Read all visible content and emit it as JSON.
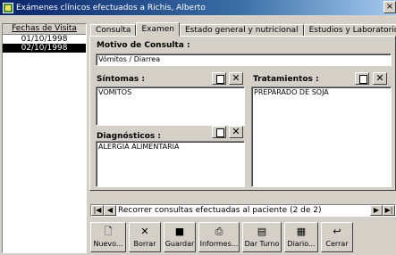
{
  "window": {
    "title": "Exámenes clínicos efectuados a Richis, Alberto",
    "close_glyph": "×"
  },
  "visits": {
    "header": "Fechas de Visita",
    "dates": [
      "01/10/1998",
      "02/10/1998"
    ]
  },
  "tabs": [
    "Consulta",
    "Examen",
    "Estado general y nutricional",
    "Estudios y Laboratorio"
  ],
  "consulta": {
    "motivo_label": "Motivo de Consulta :",
    "motivo_value": "Vómitos / Diarrea",
    "sintomas_label": "Síntomas :",
    "sintomas_value": "VOMITOS",
    "tratamientos_label": "Tratamientos :",
    "tratamientos_value": "PREPARADO DE SOJA",
    "diagnosticos_label": "Diagnósticos :",
    "diagnosticos_value": "ALERGIA ALIMENTARIA"
  },
  "navigator": {
    "text": "Recorrer consultas efectuadas al paciente (2 de 2)",
    "first": "|◀",
    "prev": "◀",
    "next": "▶",
    "last": "▶|"
  },
  "toolbar": {
    "nuevo": "Nuevo...",
    "borrar": "Borrar",
    "guardar": "Guardar",
    "informes": "Informes...",
    "dar_turno": "Dar Turno",
    "diario": "Diario...",
    "cerrar": "Cerrar"
  }
}
